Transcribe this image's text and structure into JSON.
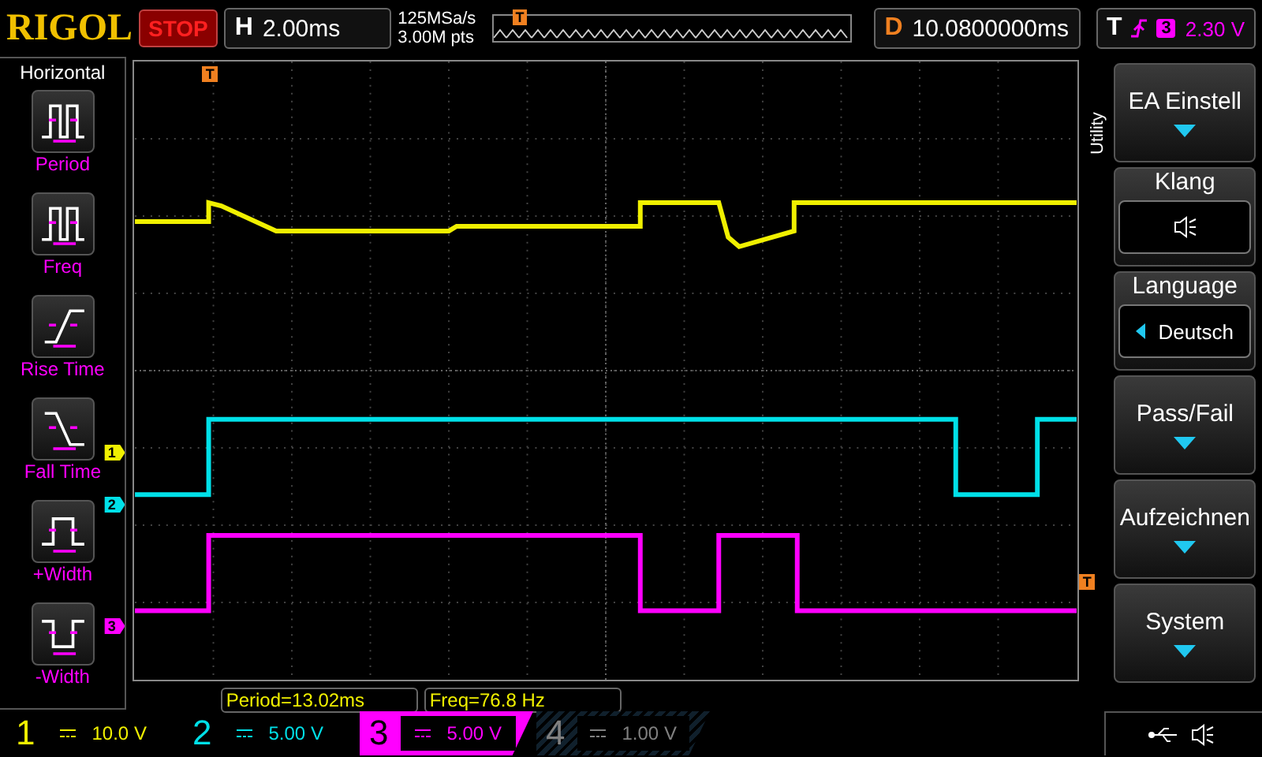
{
  "top_bar": {
    "brand": "RIGOL",
    "run_state": "STOP",
    "timebase_label": "H",
    "timebase": "2.00ms",
    "sample_rate": "125MSa/s",
    "memory_depth": "3.00M pts",
    "trigger_pos_label": "T",
    "delay_label": "D",
    "delay": "10.0800000ms",
    "trigger_label": "T",
    "trigger_source": "3",
    "trigger_level": "2.30 V"
  },
  "left_menu": {
    "title": "Horizontal",
    "items": [
      {
        "label": "Period",
        "kind": "period"
      },
      {
        "label": "Freq",
        "kind": "freq"
      },
      {
        "label": "Rise Time",
        "kind": "rise"
      },
      {
        "label": "Fall Time",
        "kind": "fall"
      },
      {
        "label": "+Width",
        "kind": "pwidth"
      },
      {
        "label": "-Width",
        "kind": "nwidth"
      }
    ]
  },
  "plot": {
    "trigger_marker": "T",
    "level_marker": "T",
    "channel_markers": [
      {
        "label": "1",
        "color": "#f0f000"
      },
      {
        "label": "2",
        "color": "#00e0e8"
      },
      {
        "label": "3",
        "color": "#ff00ff"
      }
    ]
  },
  "measurements": [
    "Period=13.02ms",
    "Freq=76.8 Hz"
  ],
  "right_menu": {
    "title": "Utility",
    "items": [
      {
        "label": "EA Einstell",
        "kind": "submenu"
      },
      {
        "label": "Klang",
        "kind": "sound"
      },
      {
        "label": "Language",
        "kind": "choice",
        "value": "Deutsch"
      },
      {
        "label": "Pass/Fail",
        "kind": "submenu"
      },
      {
        "label": "Aufzeichnen",
        "kind": "submenu"
      },
      {
        "label": "System",
        "kind": "submenu"
      }
    ]
  },
  "channels": [
    {
      "number": "1",
      "scale": "10.0 V",
      "color": "#f0f000",
      "selected": false,
      "enabled": true
    },
    {
      "number": "2",
      "scale": "5.00 V",
      "color": "#00e0e8",
      "selected": false,
      "enabled": true
    },
    {
      "number": "3",
      "scale": "5.00 V",
      "color": "#ff00ff",
      "selected": true,
      "enabled": true
    },
    {
      "number": "4",
      "scale": "1.00 V",
      "color": "#808080",
      "selected": false,
      "enabled": false
    }
  ]
}
